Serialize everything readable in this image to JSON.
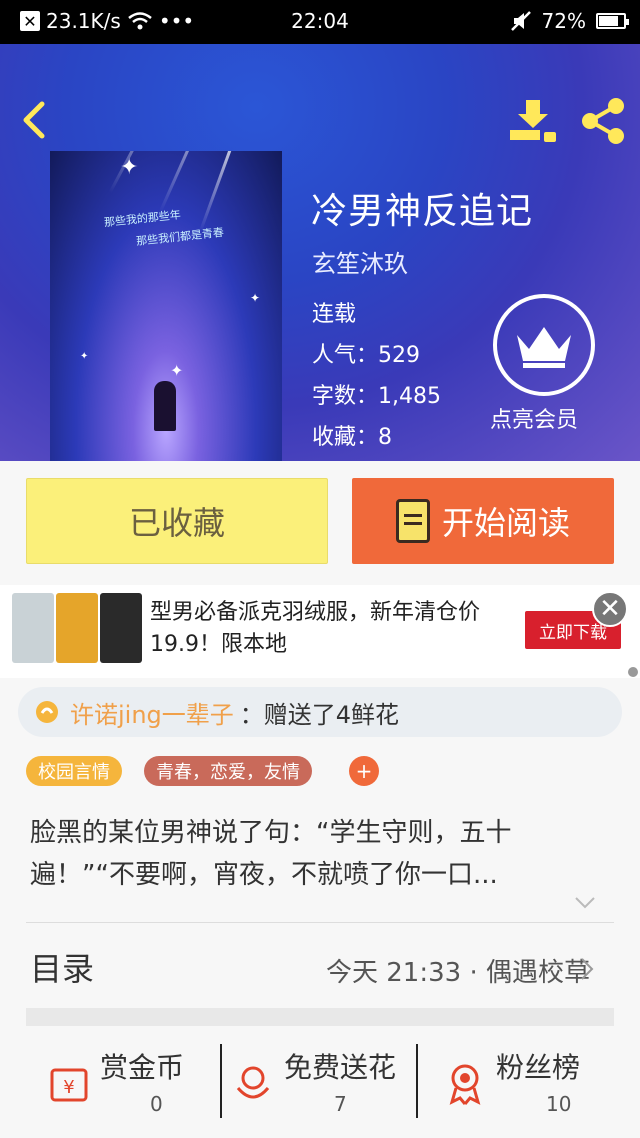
{
  "status_bar": {
    "speed": "23.1K/s",
    "dots": "•••",
    "time": "22:04",
    "battery": "72%"
  },
  "book": {
    "title": "冷男神反追记",
    "author": "玄笙沐玖",
    "status": "连载",
    "popularity": "人气：529",
    "words": "字数：1,485",
    "favorites": "收藏：8",
    "cover_text_line1": "那些我的那些年",
    "cover_text_line2": "那些我们都是青春"
  },
  "vip": {
    "label": "点亮会员"
  },
  "actions": {
    "favorited_label": "已收藏",
    "read_label": "开始阅读"
  },
  "ad": {
    "text": "型男必备派克羽绒服，新年清仓价19.9！限本地",
    "button": "立即下载",
    "close": "✕",
    "thumb_colors": [
      "#c9d2d6",
      "#e5a52a",
      "#2a2a2a"
    ]
  },
  "gift": {
    "user": "许诺jing一辈子",
    "message": "：赠送了4鲜花"
  },
  "tags": {
    "tag1": "校园言情",
    "tag2": "青春，恋爱，友情",
    "add": "+"
  },
  "synopsis": "脸黑的某位男神说了句：“学生守则，五十遍！”“不要啊，宵夜，不就喷了你一口...",
  "toc": {
    "label": "目录",
    "latest": "今天 21:33 · 偶遇校草"
  },
  "stats": [
    {
      "label": "赏金币",
      "value": "0"
    },
    {
      "label": "免费送花",
      "value": "7"
    },
    {
      "label": "粉丝榜",
      "value": "10"
    }
  ],
  "colors": {
    "accent_orange": "#f0693a",
    "accent_yellow": "#fbf07a",
    "icon_red": "#e2452c",
    "hero_blue": "#2a45c4"
  }
}
